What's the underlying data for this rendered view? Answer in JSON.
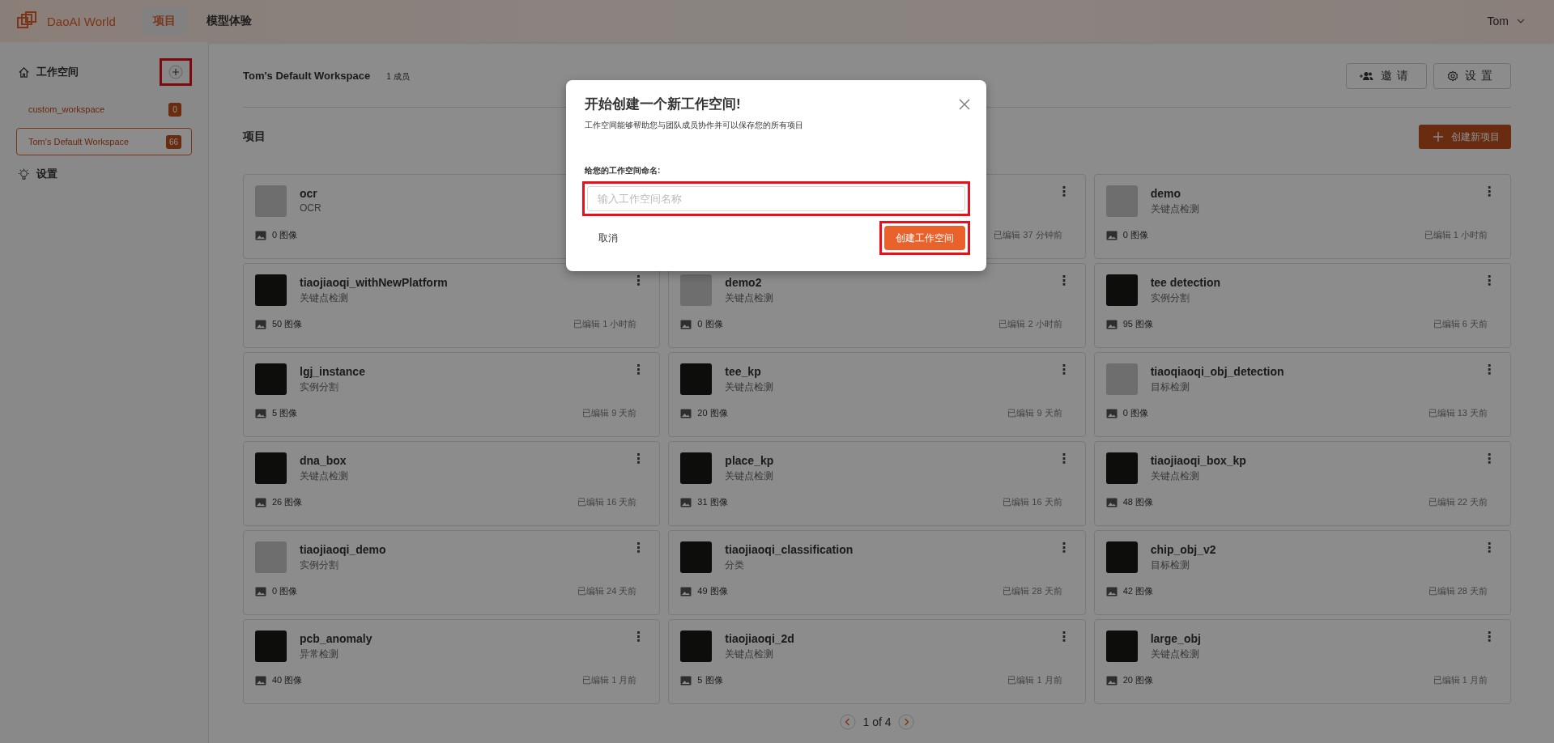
{
  "header": {
    "brand": "DaoAI World",
    "nav": [
      {
        "label": "项目",
        "selected": true
      },
      {
        "label": "模型体验",
        "selected": false
      }
    ],
    "user": "Tom"
  },
  "sidebar": {
    "heading": "工作空间",
    "add_highlighted": true,
    "workspaces": [
      {
        "name": "custom_workspace",
        "count": "0",
        "selected": false
      },
      {
        "name": "Tom's Default Workspace",
        "count": "66",
        "selected": true
      }
    ],
    "settings": "设置"
  },
  "workspace": {
    "name": "Tom's Default Workspace",
    "members": "1 成员",
    "invite": "邀请",
    "settings": "设置"
  },
  "projects": {
    "heading": "项目",
    "create": "创建新项目",
    "cards": [
      {
        "name": "ocr",
        "type": "OCR",
        "images": "0 图像",
        "kind": "empty"
      },
      {
        "edited": "已编辑 37 分钟前",
        "menu": "⋮"
      },
      {
        "name": "demo",
        "type": "关键点检测",
        "images": "0 图像",
        "edited": "已编辑 1 小时前",
        "kind": "empty",
        "menu": "⋮"
      },
      {
        "name": "tiaojiaoqi_withNewPlatform",
        "type": "关键点检测",
        "images": "50 图像",
        "edited": "已编辑 1 小时前",
        "kind": "photo",
        "menu": "⋮"
      },
      {
        "name": "demo2",
        "type": "关键点检测",
        "images": "0 图像",
        "edited": "已编辑 2 小时前",
        "kind": "empty",
        "menu": "⋮"
      },
      {
        "name": "tee detection",
        "type": "实例分割",
        "images": "95 图像",
        "edited": "已编辑 6 天前",
        "kind": "photo",
        "menu": "⋮"
      },
      {
        "name": "lgj_instance",
        "type": "实例分割",
        "images": "5 图像",
        "edited": "已编辑 9 天前",
        "kind": "photo",
        "menu": "⋮"
      },
      {
        "name": "tee_kp",
        "type": "关键点检测",
        "images": "20 图像",
        "edited": "已编辑 9 天前",
        "kind": "photo",
        "menu": "⋮"
      },
      {
        "name": "tiaoqiaoqi_obj_detection",
        "type": "目标检测",
        "images": "0 图像",
        "edited": "已编辑 13 天前",
        "kind": "empty",
        "menu": "⋮"
      },
      {
        "name": "dna_box",
        "type": "关键点检测",
        "images": "26 图像",
        "edited": "已编辑 16 天前",
        "kind": "photo",
        "menu": "⋮"
      },
      {
        "name": "place_kp",
        "type": "关键点检测",
        "images": "31 图像",
        "edited": "已编辑 16 天前",
        "kind": "photo",
        "menu": "⋮"
      },
      {
        "name": "tiaojiaoqi_box_kp",
        "type": "关键点检测",
        "images": "48 图像",
        "edited": "已编辑 22 天前",
        "kind": "photo",
        "menu": "⋮"
      },
      {
        "name": "tiaojiaoqi_demo",
        "type": "实例分割",
        "images": "0 图像",
        "edited": "已编辑 24 天前",
        "kind": "empty",
        "menu": "⋮"
      },
      {
        "name": "tiaojiaoqi_classification",
        "type": "分类",
        "images": "49 图像",
        "edited": "已编辑 28 天前",
        "kind": "photo",
        "menu": "⋮"
      },
      {
        "name": "chip_obj_v2",
        "type": "目标检测",
        "images": "42 图像",
        "edited": "已编辑 28 天前",
        "kind": "photo",
        "menu": "⋮"
      },
      {
        "name": "pcb_anomaly",
        "type": "异常检测",
        "images": "40 图像",
        "edited": "已编辑 1 月前",
        "kind": "photo",
        "menu": "⋮"
      },
      {
        "name": "tiaojiaoqi_2d",
        "type": "关键点检测",
        "images": "5 图像",
        "edited": "已编辑 1 月前",
        "kind": "photo",
        "menu": "⋮"
      },
      {
        "name": "large_obj",
        "type": "关键点检测",
        "images": "20 图像",
        "edited": "已编辑 1 月前",
        "kind": "photo",
        "menu": "⋮"
      }
    ],
    "pagination": "1 of 4"
  },
  "modal": {
    "title": "开始创建一个新工作空间!",
    "subtitle": "工作空间能够帮助您与团队成员协作并可以保存您的所有项目",
    "name_label": "给您的工作空间命名:",
    "name_field": {
      "placeholder": "输入工作空间名称",
      "highlighted": true
    },
    "cancel": "取消",
    "create": {
      "label": "创建工作空间",
      "highlighted": true
    }
  }
}
